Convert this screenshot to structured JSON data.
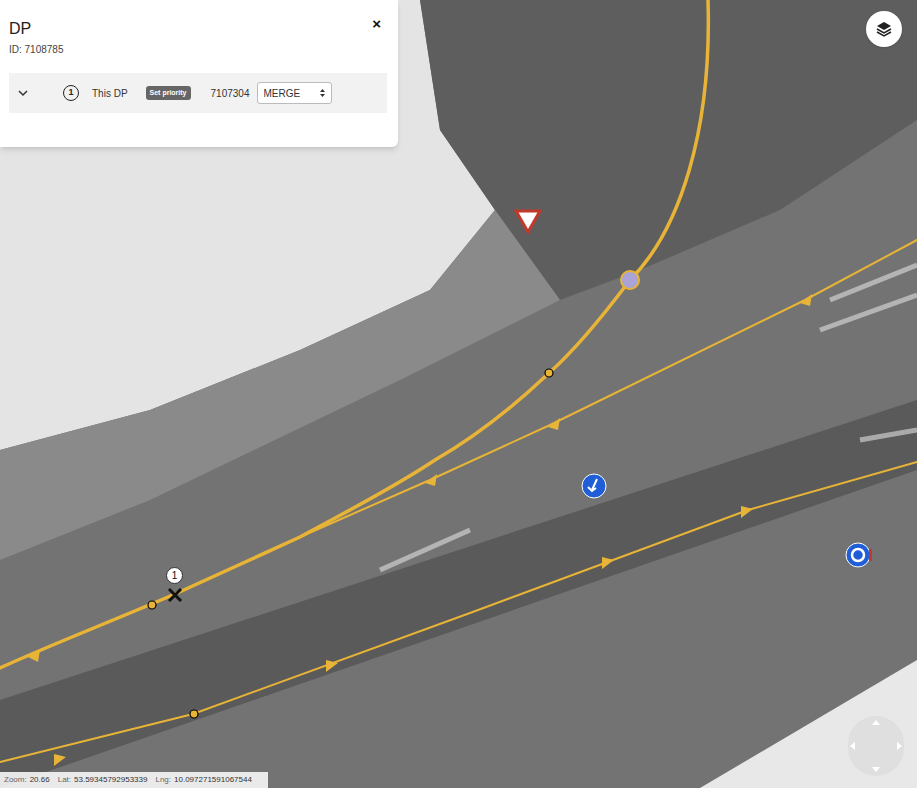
{
  "panel": {
    "title": "DP",
    "id": "ID: 7108785",
    "close": "×",
    "rows": [
      {
        "index": "1",
        "label": "This DP",
        "badge": "Set priority",
        "ref": "7107304",
        "type": "MERGE"
      }
    ]
  },
  "map": {
    "marker_label": "1"
  },
  "status_bar": {
    "zoom_label": "Zoom:",
    "zoom": "20.66",
    "lat_label": "Lat:",
    "lat": "53.59345792953339",
    "lng_label": "Lng:",
    "lng": "10.097271591067544"
  }
}
